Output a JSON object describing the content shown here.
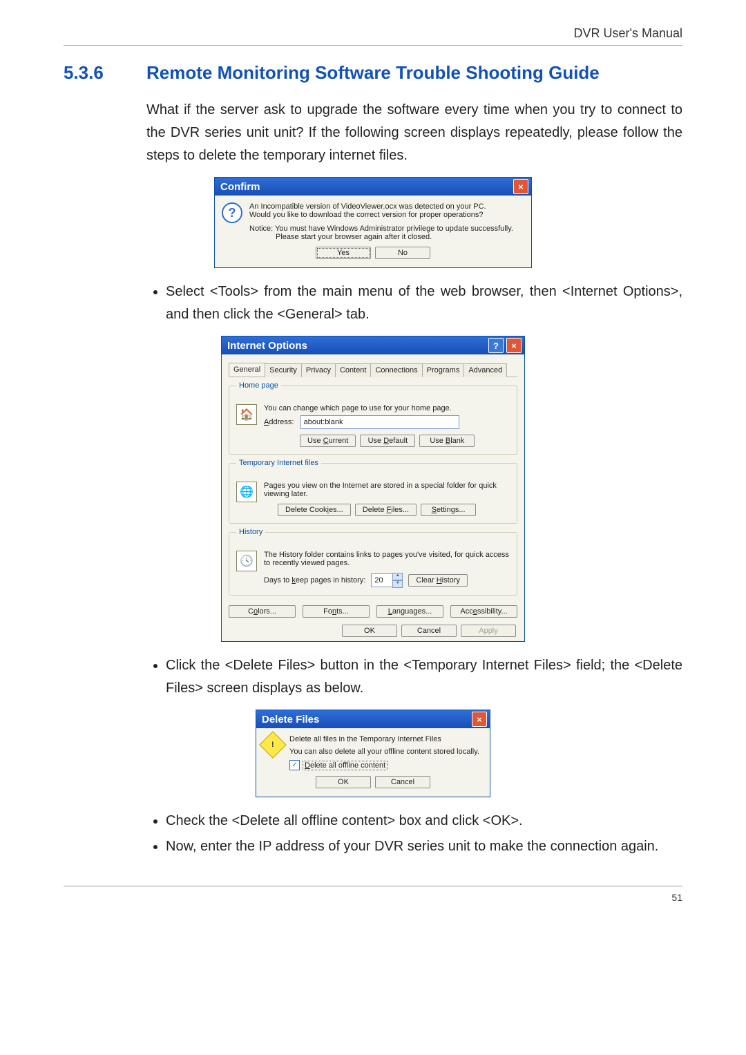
{
  "header": {
    "running": "DVR User's Manual"
  },
  "footer": {
    "page": "51"
  },
  "heading": {
    "num": "5.3.6",
    "title": "Remote Monitoring Software Trouble Shooting Guide"
  },
  "para1": "What if the server ask to upgrade the software every time when you try to connect to the DVR series unit unit? If the following screen displays repeatedly, please follow the steps to delete the temporary internet files.",
  "confirm": {
    "title": "Confirm",
    "msg1": "An Incompatible version of VideoViewer.ocx was detected on your PC.",
    "msg2": "Would you like to download the correct version for proper operations?",
    "notice": "Notice:  You must have Windows Administrator privilege to update successfully.",
    "notice2": "Please start your browser again after it closed.",
    "yes": "Yes",
    "no": "No"
  },
  "step1": "Select <Tools> from the main menu of the web browser, then <Internet Options>, and then click the <General> tab.",
  "inetopt": {
    "title": "Internet Options",
    "tabs": [
      "General",
      "Security",
      "Privacy",
      "Content",
      "Connections",
      "Programs",
      "Advanced"
    ],
    "active_tab": 0,
    "homepage": {
      "legend": "Home page",
      "desc": "You can change which page to use for your home page.",
      "addr_label": "Address:",
      "addr_value": "about:blank",
      "btn_current": "Use Current",
      "btn_default": "Use Default",
      "btn_blank": "Use Blank"
    },
    "temp": {
      "legend": "Temporary Internet files",
      "desc": "Pages you view on the Internet are stored in a special folder for quick viewing later.",
      "btn_cookies": "Delete Cookies...",
      "btn_files": "Delete Files...",
      "btn_settings": "Settings..."
    },
    "history": {
      "legend": "History",
      "desc": "The History folder contains links to pages you've visited, for quick access to recently viewed pages.",
      "days_label": "Days to keep pages in history:",
      "days_value": "20",
      "btn_clear": "Clear History"
    },
    "bottom": {
      "colors": "Colors...",
      "fonts": "Fonts...",
      "languages": "Languages...",
      "accessibility": "Accessibility..."
    },
    "footer": {
      "ok": "OK",
      "cancel": "Cancel",
      "apply": "Apply"
    }
  },
  "step2": "Click the <Delete Files> button in the <Temporary Internet Files> field; the <Delete Files> screen displays as below.",
  "delfiles": {
    "title": "Delete Files",
    "msg1": "Delete all files in the Temporary Internet Files",
    "msg2": "You can also delete all your offline content stored locally.",
    "chk": "Delete all offline content",
    "ok": "OK",
    "cancel": "Cancel"
  },
  "step3": "Check the <Delete all offline content> box and click <OK>.",
  "step4": "Now, enter the IP address of your DVR series unit to make the connection again."
}
